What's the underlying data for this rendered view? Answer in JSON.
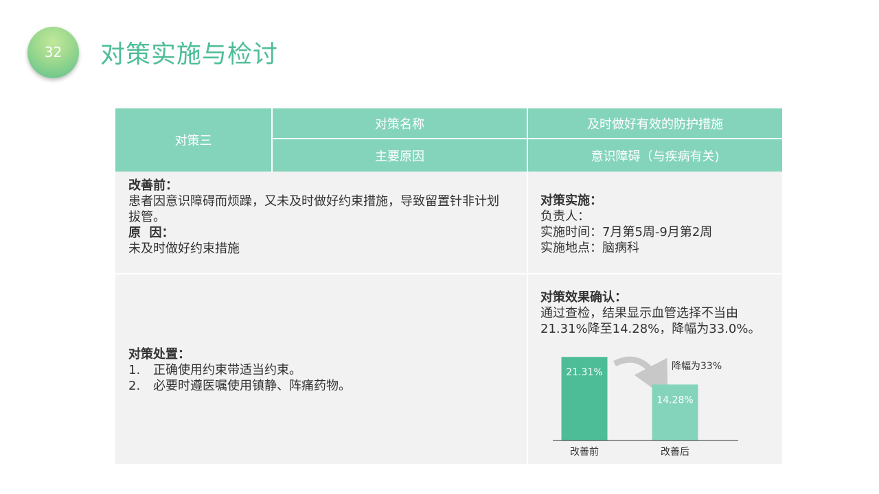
{
  "page_number": "32",
  "title": "对策实施与检讨",
  "table": {
    "header": {
      "countermeasure": "对策三",
      "name_label": "对策名称",
      "name_value": "及时做好有效的防护措施",
      "cause_label": "主要原因",
      "cause_value": "意识障碍（与疾病有关)"
    },
    "before": {
      "heading": "改善前：",
      "line1": "患者因意识障碍而烦躁，又未及时做好约束措施，导致留置针非计划",
      "line2": "拔管。",
      "reason_heading": "原  因：",
      "reason": "未及时做好约束措施"
    },
    "implementation": {
      "heading": "对策实施：",
      "owner": "负责人：",
      "time": "实施时间：7月第5周-9月第2周",
      "place": "实施地点：脑病科"
    },
    "measures": {
      "heading": "对策处置：",
      "items": [
        {
          "num": "1.",
          "text": "正确使用约束带适当约束。"
        },
        {
          "num": "2.",
          "text": "必要时遵医嘱使用镇静、阵痛药物。"
        }
      ]
    },
    "effect": {
      "heading": "对策效果确认：",
      "line1": "通过查检，结果显示血管选择不当由",
      "line2": "21.31%降至14.28%，降幅为33.0%。",
      "annotation": "降幅为33%"
    }
  },
  "chart_data": {
    "type": "bar",
    "categories": [
      "改善前",
      "改善后"
    ],
    "values": [
      21.31,
      14.28
    ],
    "data_labels": [
      "21.31%",
      "14.28%"
    ],
    "colors": [
      "#4dbd98",
      "#84d4bb"
    ],
    "ylim": [
      0,
      24.5
    ],
    "annotation": "降幅为33%",
    "grid": false
  }
}
